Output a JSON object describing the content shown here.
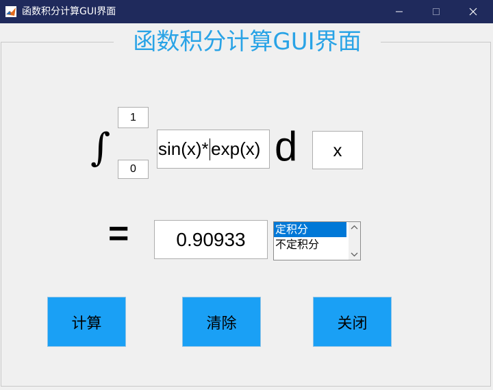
{
  "window": {
    "title": "函数积分计算GUI界面",
    "icon": "matlab-icon",
    "controls": [
      "minimize-icon",
      "maximize-icon",
      "close-icon"
    ]
  },
  "panel": {
    "title": "函数积分计算GUI界面",
    "title_color": "#29a3e6"
  },
  "integral": {
    "symbol": "∫",
    "upper_limit": "1",
    "lower_limit": "0",
    "function_before_caret": "sin(x)*",
    "function_after_caret": "exp(x)",
    "d_label": "d",
    "variable": "x"
  },
  "result": {
    "equals": "=",
    "value": "0.90933"
  },
  "integral_type": {
    "options": [
      "定积分",
      "不定积分"
    ],
    "selected": "定积分"
  },
  "buttons": {
    "calculate": "计算",
    "clear": "清除",
    "close": "关闭",
    "color": "#1aa0f5"
  }
}
